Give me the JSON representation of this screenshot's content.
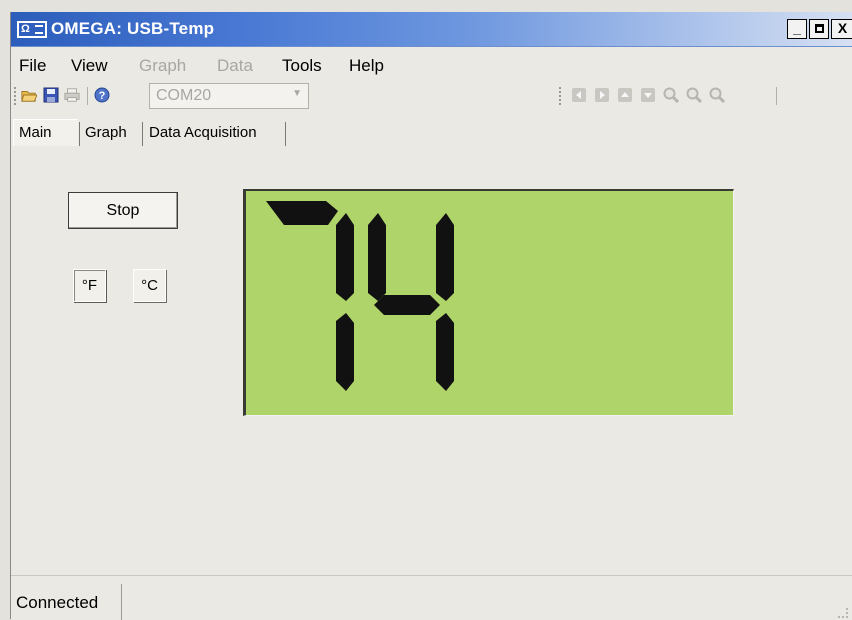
{
  "window": {
    "title": "OMEGA: USB-Temp",
    "icon": "omega-logo-icon",
    "controls": {
      "minimize": "_",
      "maximize": "□",
      "close": "X"
    }
  },
  "menu": {
    "items": [
      {
        "label": "File",
        "enabled": true
      },
      {
        "label": "View",
        "enabled": true
      },
      {
        "label": "Graph",
        "enabled": false
      },
      {
        "label": "Data",
        "enabled": false
      },
      {
        "label": "Tools",
        "enabled": true
      },
      {
        "label": "Help",
        "enabled": true
      }
    ]
  },
  "toolbar": {
    "left_icons": [
      "open-folder-icon",
      "save-icon",
      "print-icon",
      "help-icon"
    ],
    "port": {
      "value": "COM20",
      "enabled": false
    },
    "right_icons": [
      "scroll-left-icon",
      "scroll-right-icon",
      "scroll-up-icon",
      "scroll-down-icon",
      "zoom-in-icon",
      "zoom-out-icon",
      "zoom-reset-icon"
    ]
  },
  "tabs": [
    {
      "label": "Main",
      "active": true
    },
    {
      "label": "Graph",
      "active": false
    },
    {
      "label": "Data Acquisition",
      "active": false
    }
  ],
  "main": {
    "stop_label": "Stop",
    "unit_f_label": "°F",
    "unit_c_label": "°C",
    "selected_unit": "°F",
    "display_value": "74",
    "lcd_color": "#afd46a",
    "segment_color": "#111111"
  },
  "status": {
    "text": "Connected"
  },
  "colors": {
    "titlebar_start": "#2c5dbb",
    "window_bg": "#ebe9e3"
  }
}
